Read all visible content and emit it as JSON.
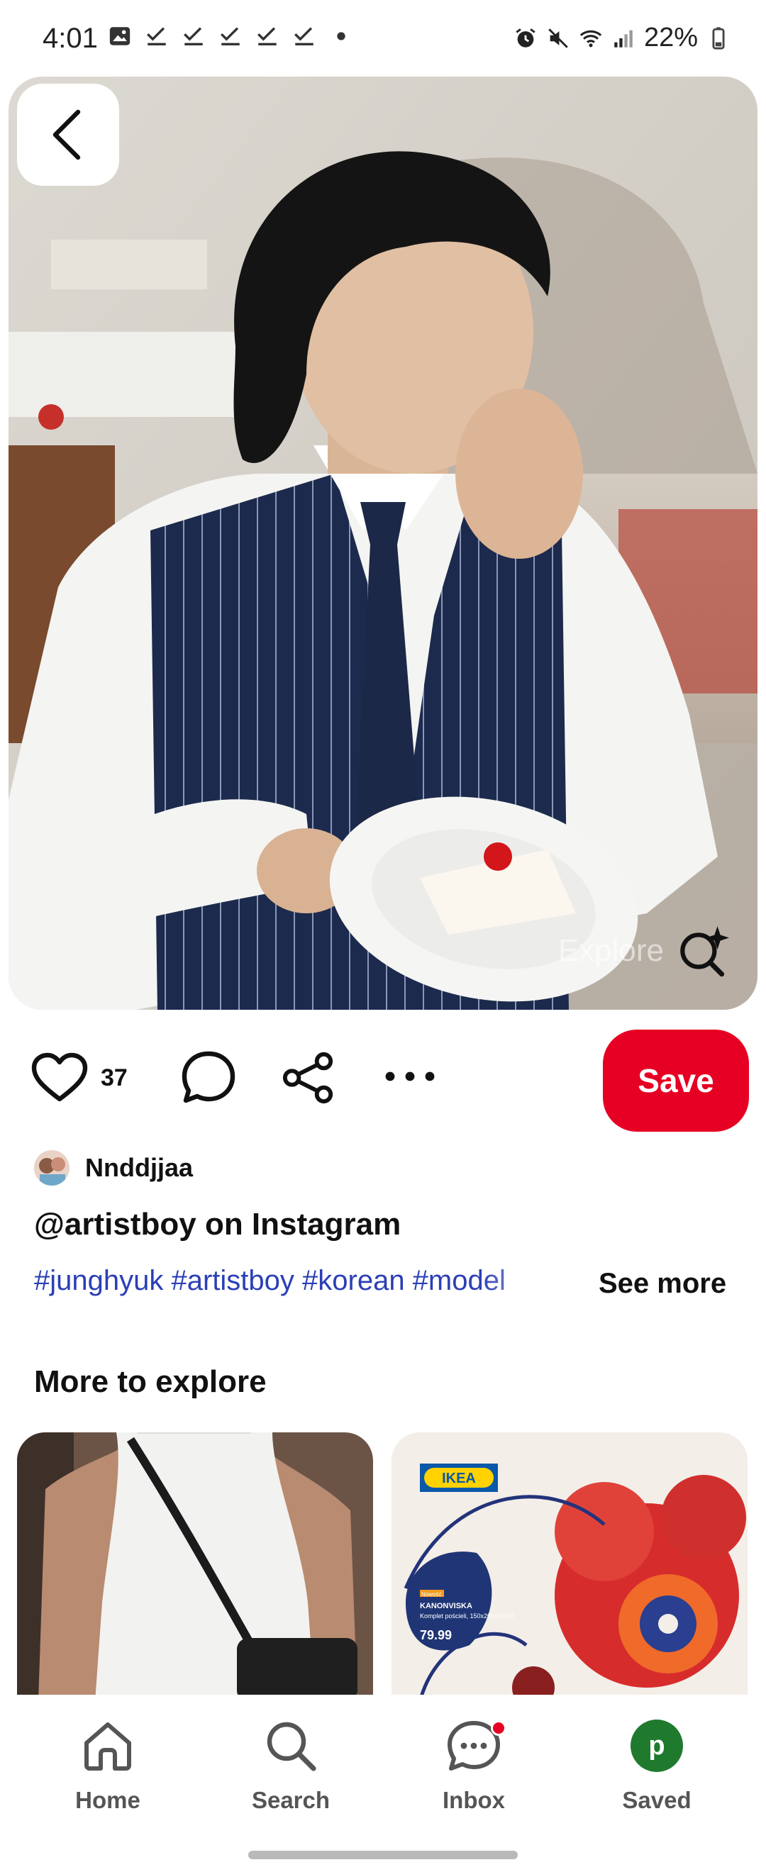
{
  "status_bar": {
    "time": "4:01",
    "battery": "22%",
    "left_icons": [
      "gallery-icon",
      "check-icon",
      "check-icon",
      "check-icon",
      "check-icon",
      "check-icon",
      "dot-icon"
    ],
    "right_icons": [
      "alarm-icon",
      "mute-icon",
      "wifi-icon",
      "signal-icon",
      "battery-icon"
    ]
  },
  "pin": {
    "explore_label": "Explore",
    "likes": "37",
    "save_label": "Save",
    "author": "Nnddjjaa",
    "title": "@artistboy on Instagram",
    "tags": "#junghyuk #artistboy #korean #model",
    "see_more": "See more"
  },
  "more_to_explore": {
    "title": "More to explore",
    "cards": [
      {
        "name": "white-tank-top-pin"
      },
      {
        "name": "ikea-bedding-pin",
        "brand": "IKEA",
        "tag": "Nowość",
        "product": "KANONVISKA",
        "desc": "Komplet pościeli, 150x200/50x60",
        "price": "79.99"
      }
    ]
  },
  "nav": {
    "home": "Home",
    "search": "Search",
    "inbox": "Inbox",
    "saved": "Saved",
    "saved_avatar_letter": "p"
  },
  "colors": {
    "accent": "#e60023",
    "tag_link": "#2b3fb5",
    "saved_avatar": "#1f7a2e"
  }
}
